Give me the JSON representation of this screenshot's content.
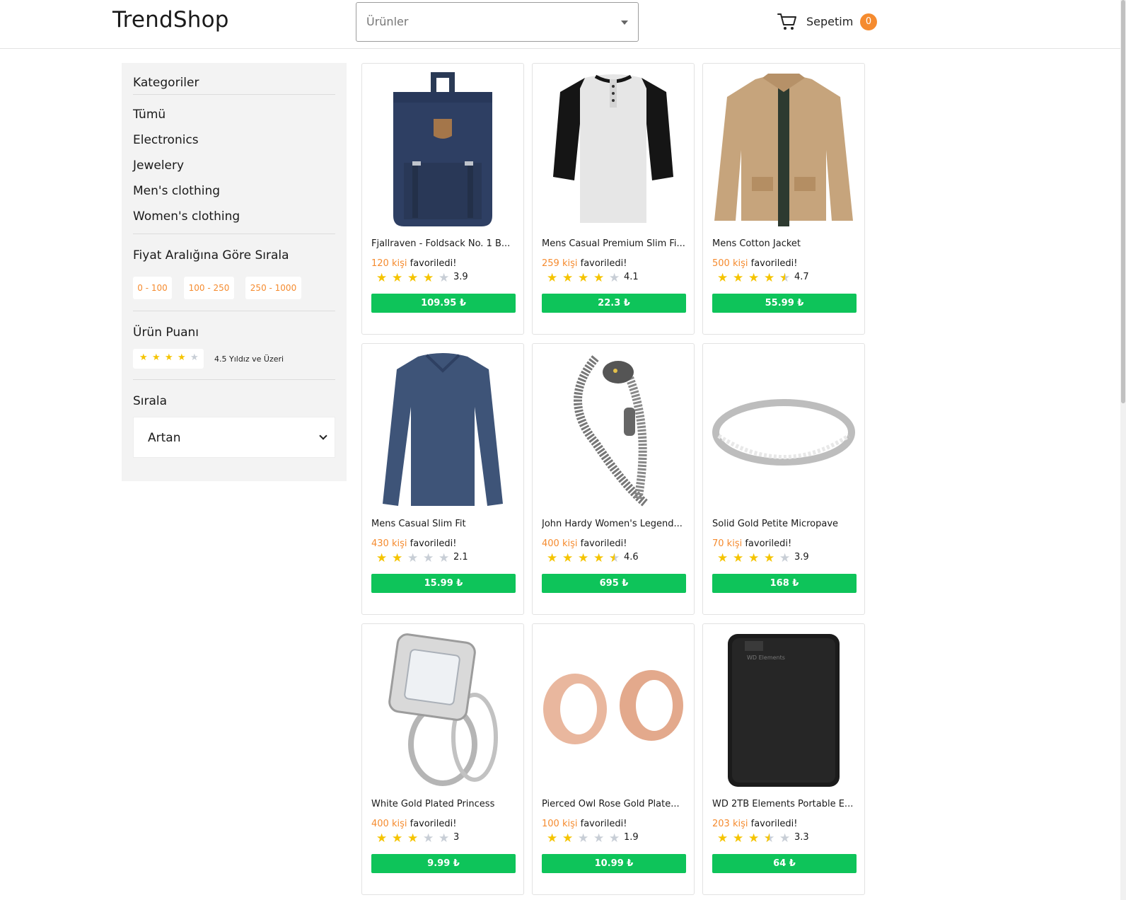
{
  "header": {
    "logo": "TrendShop",
    "search_placeholder": "Ürünler",
    "cart_label": "Sepetim",
    "cart_count": "0"
  },
  "sidebar": {
    "categories_title": "Kategoriler",
    "categories": [
      "Tümü",
      "Electronics",
      "Jewelery",
      "Men's clothing",
      "Women's clothing"
    ],
    "price_title": "Fiyat Aralığına Göre Sırala",
    "price_ranges": [
      "0 - 100",
      "100 - 250",
      "250 - 1000"
    ],
    "rating_title": "Ürün Puanı",
    "rating_filter_value": 4.5,
    "rating_filter_label": "4.5 Yıldız ve Üzeri",
    "sort_title": "Sırala",
    "sort_value": "Artan"
  },
  "products": [
    {
      "name": "Fjallraven - Foldsack No. 1 B...",
      "fav_count": "120 kişi",
      "fav_suffix": " favoriledi!",
      "rating": "3.9",
      "rating_value": 3.9,
      "price": "109.95 ₺",
      "icon": "backpack-image"
    },
    {
      "name": "Mens Casual Premium Slim Fi...",
      "fav_count": "259 kişi",
      "fav_suffix": " favoriledi!",
      "rating": "4.1",
      "rating_value": 4.1,
      "price": "22.3 ₺",
      "icon": "tshirt-image"
    },
    {
      "name": "Mens Cotton Jacket",
      "fav_count": "500 kişi",
      "fav_suffix": " favoriledi!",
      "rating": "4.7",
      "rating_value": 4.7,
      "price": "55.99 ₺",
      "icon": "jacket-image"
    },
    {
      "name": "Mens Casual Slim Fit",
      "fav_count": "430 kişi",
      "fav_suffix": " favoriledi!",
      "rating": "2.1",
      "rating_value": 2.1,
      "price": "15.99 ₺",
      "icon": "longsleeve-image"
    },
    {
      "name": "John Hardy Women's Legend...",
      "fav_count": "400 kişi",
      "fav_suffix": " favoriledi!",
      "rating": "4.6",
      "rating_value": 4.6,
      "price": "695 ₺",
      "icon": "bracelet-image"
    },
    {
      "name": "Solid Gold Petite Micropave",
      "fav_count": "70 kişi",
      "fav_suffix": " favoriledi!",
      "rating": "3.9",
      "rating_value": 3.9,
      "price": "168 ₺",
      "icon": "ring-image"
    },
    {
      "name": "White Gold Plated Princess",
      "fav_count": "400 kişi",
      "fav_suffix": " favoriledi!",
      "rating": "3",
      "rating_value": 3,
      "price": "9.99 ₺",
      "icon": "diamond-ring-image"
    },
    {
      "name": "Pierced Owl Rose Gold Plate...",
      "fav_count": "100 kişi",
      "fav_suffix": " favoriledi!",
      "rating": "1.9",
      "rating_value": 1.9,
      "price": "10.99 ₺",
      "icon": "earrings-image"
    },
    {
      "name": "WD 2TB Elements Portable E...",
      "fav_count": "203 kişi",
      "fav_suffix": " favoriledi!",
      "rating": "3.3",
      "rating_value": 3.3,
      "price": "64 ₺",
      "icon": "hard-drive-image",
      "image_text": "WD Elements"
    }
  ],
  "colors": {
    "accent_orange": "#f58b2f",
    "price_green": "#0ec45a",
    "star_yellow": "#f5c400",
    "star_empty": "#c8ced6"
  }
}
